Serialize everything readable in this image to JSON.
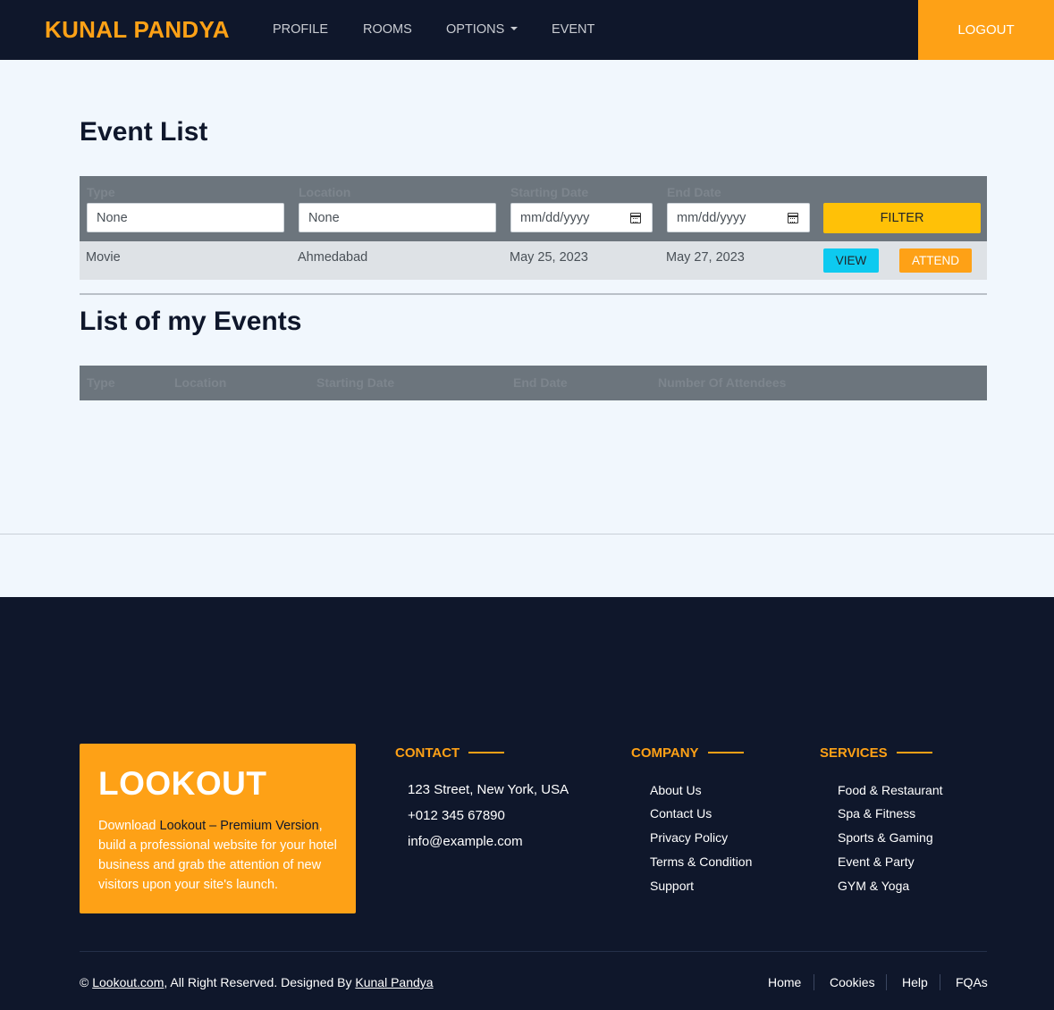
{
  "navbar": {
    "brand": "KUNAL PANDYA",
    "links": [
      "PROFILE",
      "ROOMS",
      "OPTIONS",
      "EVENT"
    ],
    "logout": "LOGOUT"
  },
  "event_list": {
    "title": "Event List",
    "columns": [
      "Type",
      "Location",
      "Starting Date",
      "End Date"
    ],
    "type_value": "None",
    "location_value": "None",
    "start_placeholder": "mm/dd/yyyy",
    "end_placeholder": "mm/dd/yyyy",
    "filter_label": "FILTER",
    "rows": [
      {
        "type": "Movie",
        "location": "Ahmedabad",
        "start": "May 25, 2023",
        "end": "May 27, 2023",
        "view": "VIEW",
        "attend": "ATTEND"
      }
    ]
  },
  "my_events": {
    "title": "List of my Events",
    "columns": [
      "Type",
      "Location",
      "Starting Date",
      "End Date",
      "Number Of Attendees"
    ]
  },
  "footer": {
    "promo_title": "LOOKOUT",
    "promo_text_1": "Download ",
    "promo_link": "Lookout – Premium Version",
    "promo_text_2": ", build a professional website for your hotel business and grab the attention of new visitors upon your site's launch.",
    "contact_heading": "CONTACT",
    "contact": [
      "123 Street, New York, USA",
      "+012 345 67890",
      "info@example.com"
    ],
    "company_heading": "COMPANY",
    "company": [
      "About Us",
      "Contact Us",
      "Privacy Policy",
      "Terms & Condition",
      "Support"
    ],
    "services_heading": "SERVICES",
    "services": [
      "Food & Restaurant",
      "Spa & Fitness",
      "Sports & Gaming",
      "Event & Party",
      "GYM & Yoga"
    ],
    "copyright_prefix": "© ",
    "copyright_site": "Lookout.com",
    "copyright_mid": ", All Right Reserved. Designed By ",
    "copyright_author": "Kunal Pandya",
    "bottom_links": [
      "Home",
      "Cookies",
      "Help",
      "FQAs"
    ]
  },
  "colors": {
    "primary": "#fea116",
    "dark": "#0f172b",
    "warning": "#ffc107",
    "info": "#0dcaf0",
    "table_head": "#6c757d"
  }
}
